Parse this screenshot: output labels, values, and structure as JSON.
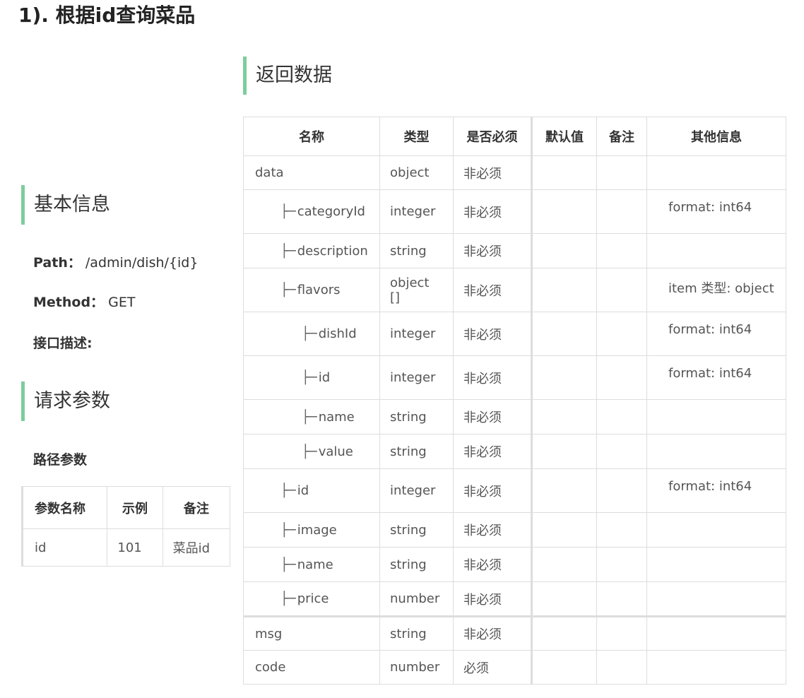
{
  "title": "1). 根据id查询菜品",
  "basic_info": {
    "heading": "基本信息",
    "path_label": "Path：",
    "path_value": "/admin/dish/{id}",
    "method_label": "Method：",
    "method_value": "GET",
    "desc_label": "接口描述:"
  },
  "request": {
    "heading": "请求参数",
    "path_params_heading": "路径参数",
    "columns": [
      "参数名称",
      "示例",
      "备注"
    ],
    "rows": [
      [
        "id",
        "101",
        "菜品id"
      ]
    ]
  },
  "response": {
    "heading": "返回数据",
    "columns": [
      "名称",
      "类型",
      "是否必须",
      "默认值",
      "备注",
      "其他信息"
    ],
    "tree_glyph": "├─",
    "rows": [
      {
        "name": "data",
        "type": "object",
        "required": "非必须",
        "default": "",
        "note": "",
        "extra": ""
      },
      {
        "name": "categoryId",
        "type": "integer",
        "required": "非必须",
        "default": "",
        "note": "",
        "extra": "format: int64"
      },
      {
        "name": "description",
        "type": "string",
        "required": "非必须",
        "default": "",
        "note": "",
        "extra": ""
      },
      {
        "name": "flavors",
        "type": "object []",
        "required": "非必须",
        "default": "",
        "note": "",
        "extra": "item 类型: object"
      },
      {
        "name": "dishId",
        "type": "integer",
        "required": "非必须",
        "default": "",
        "note": "",
        "extra": "format: int64"
      },
      {
        "name": "id",
        "type": "integer",
        "required": "非必须",
        "default": "",
        "note": "",
        "extra": "format: int64"
      },
      {
        "name": "name",
        "type": "string",
        "required": "非必须",
        "default": "",
        "note": "",
        "extra": ""
      },
      {
        "name": "value",
        "type": "string",
        "required": "非必须",
        "default": "",
        "note": "",
        "extra": ""
      },
      {
        "name": "id",
        "type": "integer",
        "required": "非必须",
        "default": "",
        "note": "",
        "extra": "format: int64"
      },
      {
        "name": "image",
        "type": "string",
        "required": "非必须",
        "default": "",
        "note": "",
        "extra": ""
      },
      {
        "name": "name",
        "type": "string",
        "required": "非必须",
        "default": "",
        "note": "",
        "extra": ""
      },
      {
        "name": "price",
        "type": "number",
        "required": "非必须",
        "default": "",
        "note": "",
        "extra": ""
      },
      {
        "name": "msg",
        "type": "string",
        "required": "非必须",
        "default": "",
        "note": "",
        "extra": ""
      },
      {
        "name": "code",
        "type": "number",
        "required": "必须",
        "default": "",
        "note": "",
        "extra": ""
      }
    ]
  },
  "colors": {
    "accent": "#7dcd9d",
    "border": "#dddddd",
    "text": "#555555",
    "heading": "#333333"
  }
}
